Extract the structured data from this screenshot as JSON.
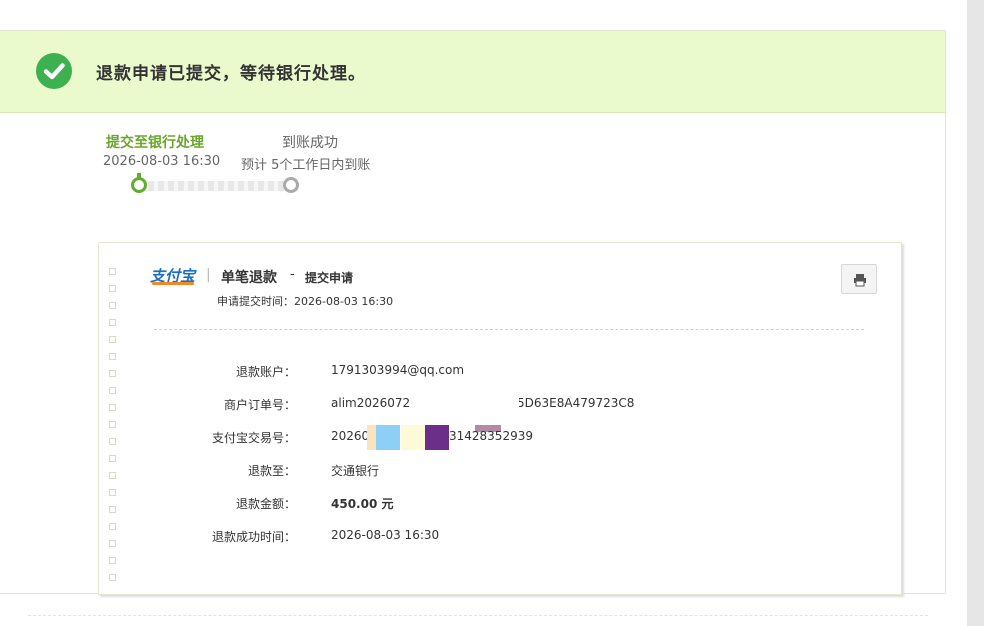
{
  "banner": {
    "message": "退款申请已提交，等待银行处理。",
    "status_color": "#3db04f"
  },
  "progress": {
    "steps": [
      {
        "label": "提交至银行处理",
        "detail": "2026-08-03 16:30",
        "state": "done"
      },
      {
        "label": "到账成功",
        "detail": "预计 5个工作日内到账",
        "state": "pending"
      }
    ],
    "completed_fraction": 0.0
  },
  "receipt": {
    "logo": "支付宝",
    "title": "单笔退款",
    "title_sep": "-",
    "subtitle": "提交申请",
    "submit_time": "申请提交时间：2026-08-03 16:30",
    "print_icon": "printer-icon",
    "fields": [
      {
        "label": "退款账户：",
        "value": "1791303994@qq.com"
      },
      {
        "label": "商户订单号：",
        "value_prefix": "alim2026072",
        "value_suffix": "5D63E8A479723C8"
      },
      {
        "label": "支付宝交易号：",
        "value_prefix": "202607",
        "value_suffix": "31428352939"
      },
      {
        "label": "退款至：",
        "value": "交通银行"
      },
      {
        "label": "退款金额：",
        "value": "450.00 元"
      },
      {
        "label": "退款成功时间：",
        "value": "2026-08-03 16:30"
      }
    ]
  },
  "colors": {
    "accent_green": "#6aa62c",
    "banner_bg": "#eafacd",
    "logo_blue": "#1b6ec2"
  }
}
